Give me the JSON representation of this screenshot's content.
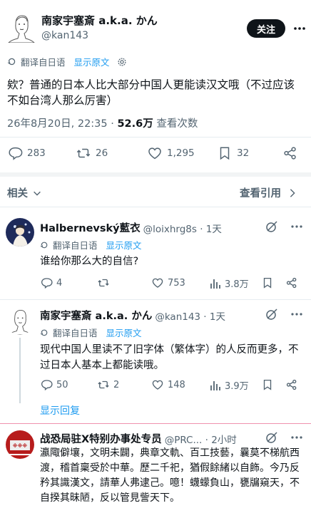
{
  "main_tweet": {
    "author_name": "南家宇塞斎 a.k.a. かん",
    "handle": "@kan143",
    "follow_label": "关注",
    "translate_label": "翻译自日语",
    "show_original": "显示原文",
    "text": "欸？普通的日本人比大部分中国人更能读汉文哦（不过应该不如台湾人那么厉害）",
    "timestamp": "26年8月20日, 22:35 · ",
    "views_count": "52.6万",
    "views_label": " 查看次数",
    "replies": "283",
    "retweets": "26",
    "likes": "1,295",
    "bookmarks": "32"
  },
  "related_label": "相关",
  "view_quotes_label": "查看引用",
  "replies": [
    {
      "author_name": "Halbernevský藍衣",
      "handle": "@loixhrg8s · 1天",
      "translate_label": "翻译自日语",
      "show_original": "显示原文",
      "text": "谁给你那么大的自信?",
      "replies": "4",
      "retweets": "",
      "likes": "753",
      "views": "3.8万"
    },
    {
      "author_name": "南家宇塞斎 a.k.a. かん",
      "handle": "@kan143 · 1天",
      "translate_label": "翻译自日语",
      "show_original": "显示原文",
      "text": "现代中国人里读不了旧字体（繁体字）的人反而更多，不过日本人基本上都能读哦。",
      "replies": "50",
      "retweets": "2",
      "likes": "148",
      "views": "3.9万"
    }
  ],
  "show_replies_label": "显示回复",
  "third_reply": {
    "author_name": "战恐局驻X特别办事处专员",
    "handle": "@PRC... · 2小时",
    "text": "瀛陬僻壤，文明未闢，典章文軌、百工技藝，曩莫不梯航西渡，稽首稟受於中華。歷二千祀，猶假餘緒以自飾。今乃反矜其識漢文，請華人弗逮己。噫！蠛蠓負山，甕牖窺天，不自揆其昧陋，反以管見訾天下。"
  },
  "colors": {
    "accent": "#1d9bf0",
    "muted": "#536471",
    "text": "#0f1419",
    "divider": "#e6ecf0"
  },
  "icons": [
    "translate-icon",
    "gear-icon",
    "reply-icon",
    "retweet-icon",
    "like-icon",
    "bookmark-icon",
    "share-icon",
    "views-icon",
    "more-icon",
    "grok-icon",
    "chevron-down-icon",
    "chevron-right-icon"
  ]
}
